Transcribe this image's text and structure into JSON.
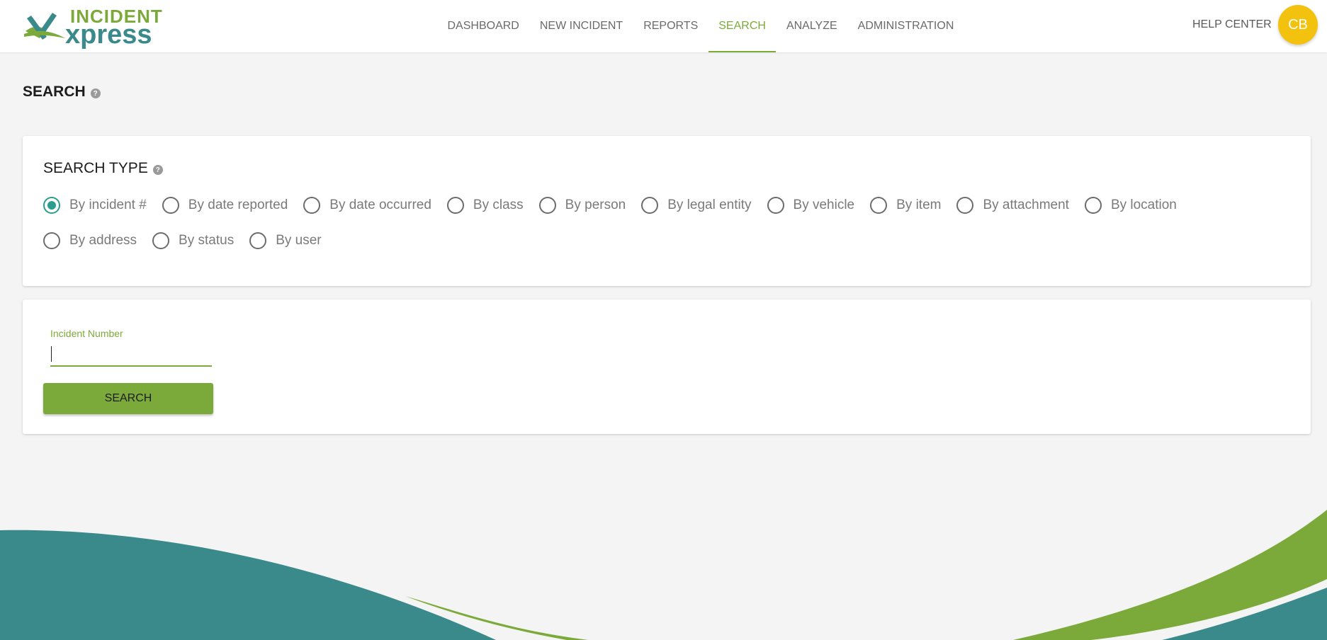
{
  "app": {
    "logo_top": "INCIDENT",
    "logo_bottom": "xpress"
  },
  "nav": {
    "items": [
      {
        "label": "DASHBOARD"
      },
      {
        "label": "NEW INCIDENT"
      },
      {
        "label": "REPORTS"
      },
      {
        "label": "SEARCH",
        "active": true
      },
      {
        "label": "ANALYZE"
      },
      {
        "label": "ADMINISTRATION"
      }
    ],
    "help_label": "HELP CENTER",
    "avatar_initials": "CB"
  },
  "page": {
    "title": "SEARCH",
    "help_icon": "question-circle-icon"
  },
  "search_type": {
    "title": "SEARCH TYPE",
    "options": [
      {
        "label": "By incident #",
        "checked": true
      },
      {
        "label": "By date reported",
        "checked": false
      },
      {
        "label": "By date occurred",
        "checked": false
      },
      {
        "label": "By class",
        "checked": false
      },
      {
        "label": "By person",
        "checked": false
      },
      {
        "label": "By legal entity",
        "checked": false
      },
      {
        "label": "By vehicle",
        "checked": false
      },
      {
        "label": "By item",
        "checked": false
      },
      {
        "label": "By attachment",
        "checked": false
      },
      {
        "label": "By location",
        "checked": false
      },
      {
        "label": "By address",
        "checked": false
      },
      {
        "label": "By status",
        "checked": false
      },
      {
        "label": "By user",
        "checked": false
      }
    ]
  },
  "form": {
    "field_label": "Incident Number",
    "field_value": "",
    "search_button": "SEARCH"
  },
  "colors": {
    "accent_green": "#7caa3a",
    "accent_teal": "#3a8a8c",
    "radio_checked": "#2a9d8f",
    "avatar": "#f2c20e"
  }
}
